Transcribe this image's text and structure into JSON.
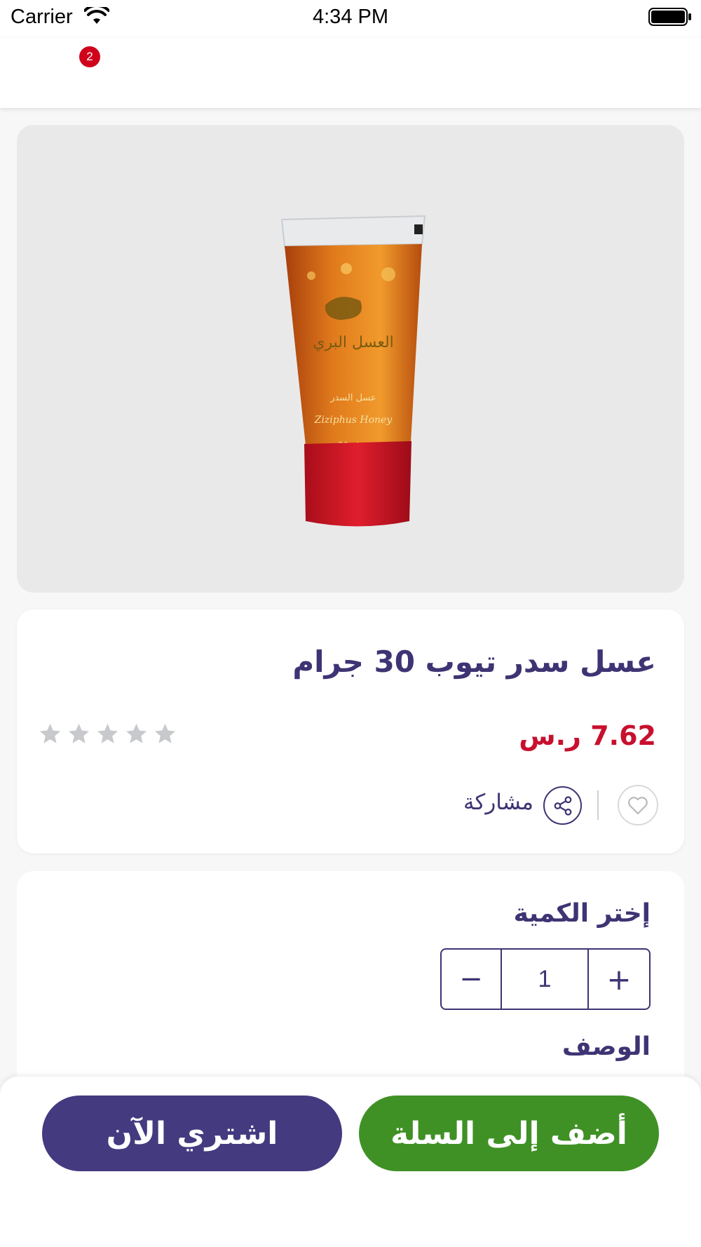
{
  "status_bar": {
    "carrier": "Carrier",
    "time": "4:34 PM"
  },
  "nav": {
    "cart_count": "2"
  },
  "product": {
    "title": "عسل سدر تيوب 30 جرام",
    "price": "7.62 ر.س",
    "rating": 0,
    "rating_max": 5,
    "share_label": "مشاركة",
    "image_text": {
      "brand": "العسل البري",
      "type_ar": "عسل السدر",
      "type_en": "Ziziphus Honey",
      "weight": "30 جرام"
    }
  },
  "quantity": {
    "label": "إختر الكمية",
    "value": "1",
    "minus": "−",
    "plus": "+"
  },
  "description": {
    "label": "الوصف"
  },
  "actions": {
    "buy_now": "اشتري الآن",
    "add_to_cart": "أضف إلى السلة"
  },
  "colors": {
    "brand_purple": "#3e3473",
    "price_red": "#c8102e",
    "buy_button": "#433a80",
    "cart_button": "#3f9125",
    "badge_red": "#d0021b"
  },
  "icons": [
    "wifi-icon",
    "battery-icon",
    "star-icon",
    "heart-icon",
    "share-icon"
  ]
}
